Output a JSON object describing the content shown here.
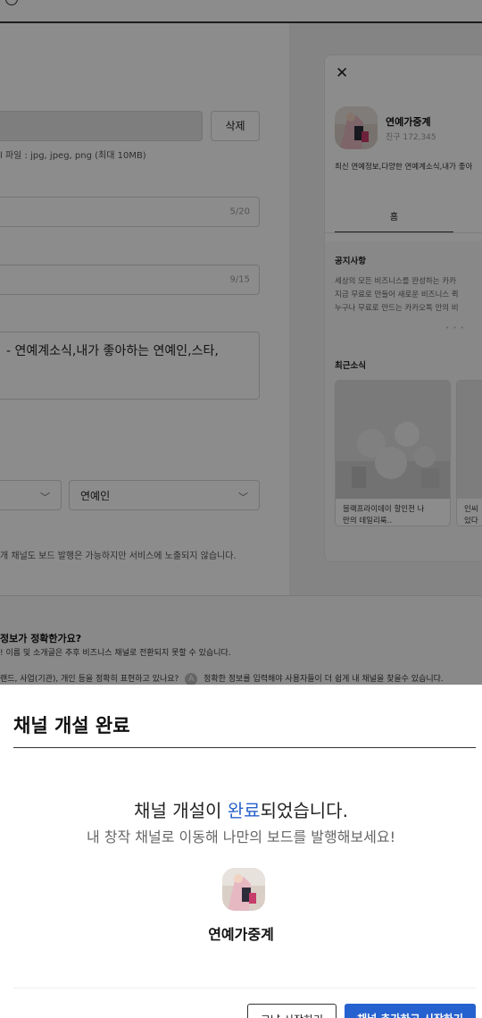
{
  "background": {
    "form": {
      "delete_button": "삭제",
      "file_hint": "l 파일 : jpg, jpeg, png (최대 10MB)",
      "name_counter": "5/20",
      "search_counter": "9/15",
      "description_text": "- 연예계소식,내가 좋아하는 연예인,스타,",
      "category_value": "연예인",
      "visibility_hint": "개 채널도 보드 발행은 가능하지만 서비스에 노출되지 않습니다."
    },
    "footer": {
      "question_title": "정보가 정확한가요?",
      "question_sub": "! 이름 및 소개글은 추후 비즈니스 채널로 전환되지 못할 수 있습니다.",
      "question_line": "랜드, 사업(기관), 개인 등을 정확히 표현하고 있나요?",
      "badge": "A",
      "answer_line": "정확한 정보를 입력해야 사용자들이 더 쉽게 내 채널을 찾을수 있습니다."
    },
    "preview": {
      "close_symbol": "✕",
      "channel_name": "연예가중계",
      "friends": "친구 172,345",
      "intro": "최신 연예정보,다양한 연예계소식,내가 좋아",
      "tab_home": "홈",
      "notice_title": "공지사항",
      "notice_lines": [
        "세상의 모든 비즈니스를 완성하는 카카",
        "지금 무료로 만들어 새로운 비즈니스 퀵",
        "누구나 무료로 만드는 카카오톡 안의 비"
      ],
      "dots": "• • •",
      "news_title": "최근소식",
      "news1_caption": [
        "블랙프라이데이 할인전 나",
        "만의 데일리룩.."
      ],
      "news2_caption": [
        "인씨",
        "있다"
      ]
    }
  },
  "modal": {
    "title": "채널 개설 완료",
    "message_before": "채널 개설이 ",
    "message_highlight": "완료",
    "message_after": "되었습니다.",
    "sub_message": "내 창작 채널로 이동해 나만의 보드를 발행해보세요!",
    "channel_name": "연예가중계",
    "button_start": "그냥 시작하기",
    "button_add": "채널 추가하고 시작하기"
  },
  "colors": {
    "accent": "#2561cf",
    "highlight_text": "#2a63c9"
  }
}
